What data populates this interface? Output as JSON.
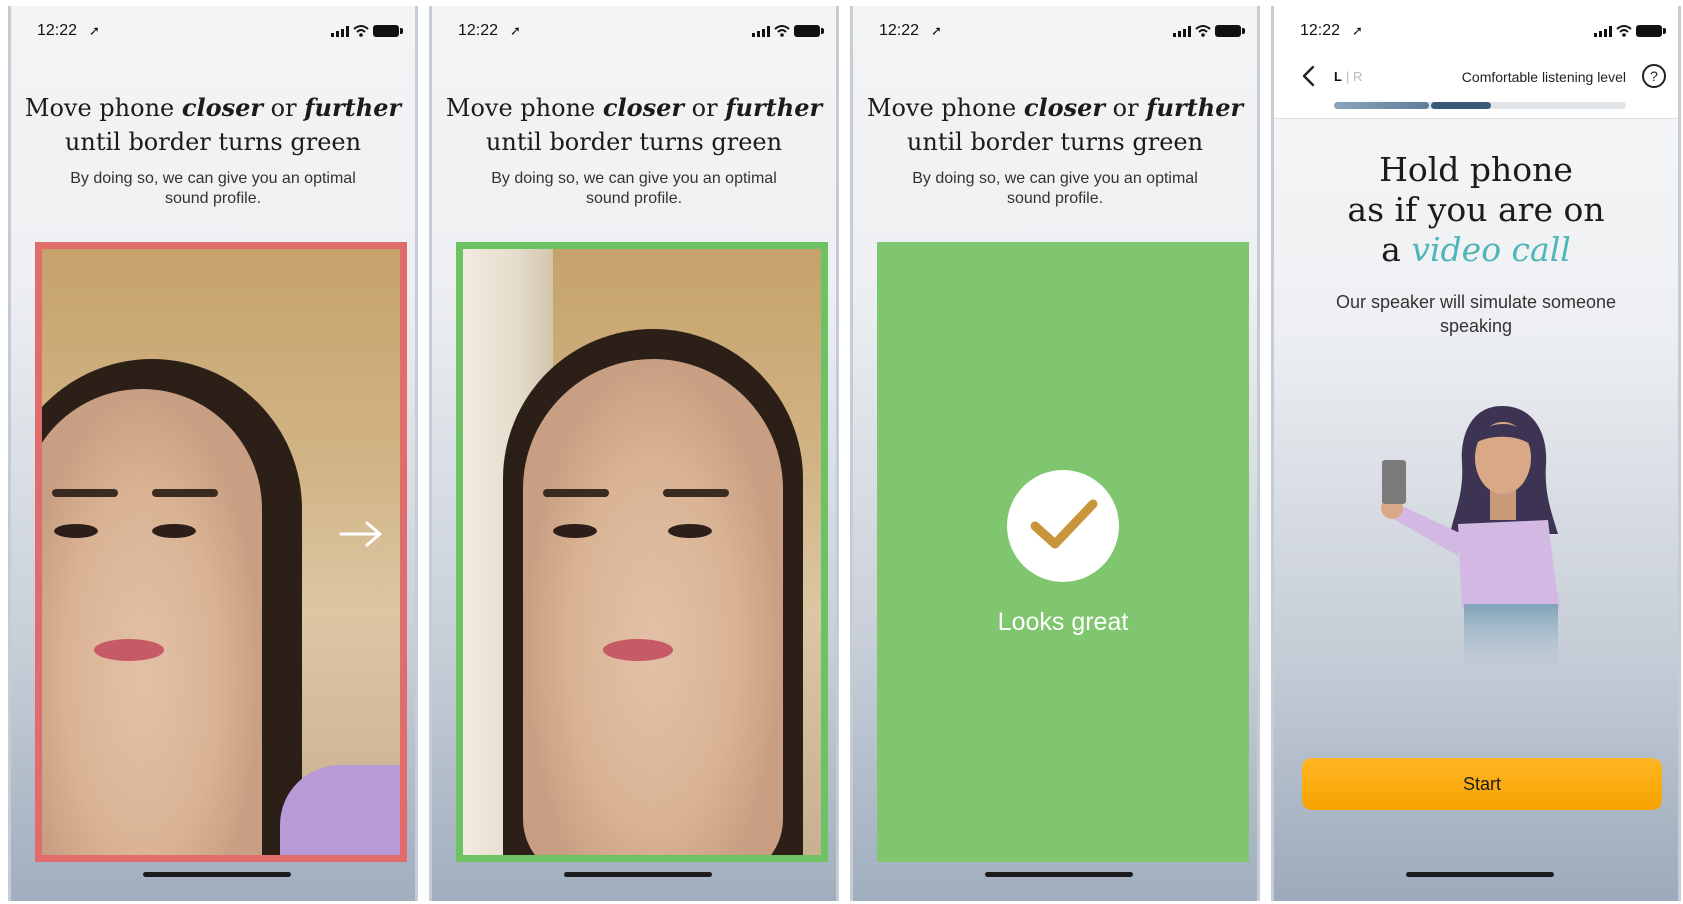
{
  "status": {
    "time": "12:22"
  },
  "screens": [
    {
      "heading": {
        "pre": "Move phone ",
        "closer": "closer",
        "mid": " or ",
        "further": "further",
        "line2": "until border turns green"
      },
      "sub": "By doing so, we can give you an optimal sound profile.",
      "border_color": "#e06c6c"
    },
    {
      "heading": {
        "pre": "Move phone ",
        "closer": "closer",
        "mid": " or ",
        "further": "further",
        "line2": "until border turns green"
      },
      "sub": "By doing so, we can give you an optimal sound profile.",
      "border_color": "#6dc264"
    },
    {
      "heading": {
        "pre": "Move phone ",
        "closer": "closer",
        "mid": " or ",
        "further": "further",
        "line2": "until border turns green"
      },
      "sub": "By doing so, we can give you an optimal sound profile.",
      "success_label": "Looks great"
    },
    {
      "nav": {
        "ear_left": "L",
        "ear_separator": "|",
        "ear_right": "R",
        "title": "Comfortable listening level",
        "help": "?"
      },
      "progress_percent": 54,
      "heading": {
        "line1": "Hold phone",
        "line2": "as if you are on",
        "line3_pre": "a ",
        "line3_em": "video call"
      },
      "sub": "Our speaker will simulate someone speaking",
      "start_label": "Start"
    }
  ],
  "colors": {
    "accent_orange": "#f6a300",
    "success_green": "#7fc66e",
    "teal": "#4eb6b8",
    "error_red": "#e06c6c"
  }
}
